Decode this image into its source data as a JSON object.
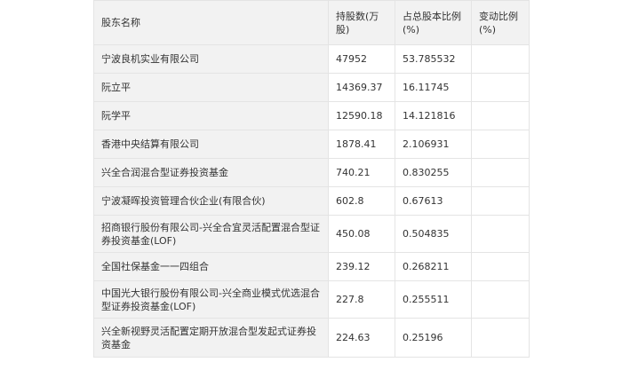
{
  "table": {
    "headers": [
      "股东名称",
      "持股数(万股)",
      "占总股本比例(%)",
      "变动比例(%)"
    ],
    "rows": [
      {
        "name": "宁波良机实业有限公司",
        "shares": "47952",
        "ratio": "53.785532",
        "change": ""
      },
      {
        "name": "阮立平",
        "shares": "14369.37",
        "ratio": "16.11745",
        "change": ""
      },
      {
        "name": "阮学平",
        "shares": "12590.18",
        "ratio": "14.121816",
        "change": ""
      },
      {
        "name": "香港中央结算有限公司",
        "shares": "1878.41",
        "ratio": "2.106931",
        "change": ""
      },
      {
        "name": "兴全合润混合型证券投资基金",
        "shares": "740.21",
        "ratio": "0.830255",
        "change": ""
      },
      {
        "name": "宁波凝晖投资管理合伙企业(有限合伙)",
        "shares": "602.8",
        "ratio": "0.67613",
        "change": ""
      },
      {
        "name": "招商银行股份有限公司-兴全合宜灵活配置混合型证券投资基金(LOF)",
        "shares": "450.08",
        "ratio": "0.504835",
        "change": ""
      },
      {
        "name": "全国社保基金一一四组合",
        "shares": "239.12",
        "ratio": "0.268211",
        "change": ""
      },
      {
        "name": "中国光大银行股份有限公司-兴全商业模式优选混合型证券投资基金(LOF)",
        "shares": "227.8",
        "ratio": "0.255511",
        "change": ""
      },
      {
        "name": "兴全新视野灵活配置定期开放混合型发起式证券投资基金",
        "shares": "224.63",
        "ratio": "0.25196",
        "change": ""
      }
    ]
  }
}
